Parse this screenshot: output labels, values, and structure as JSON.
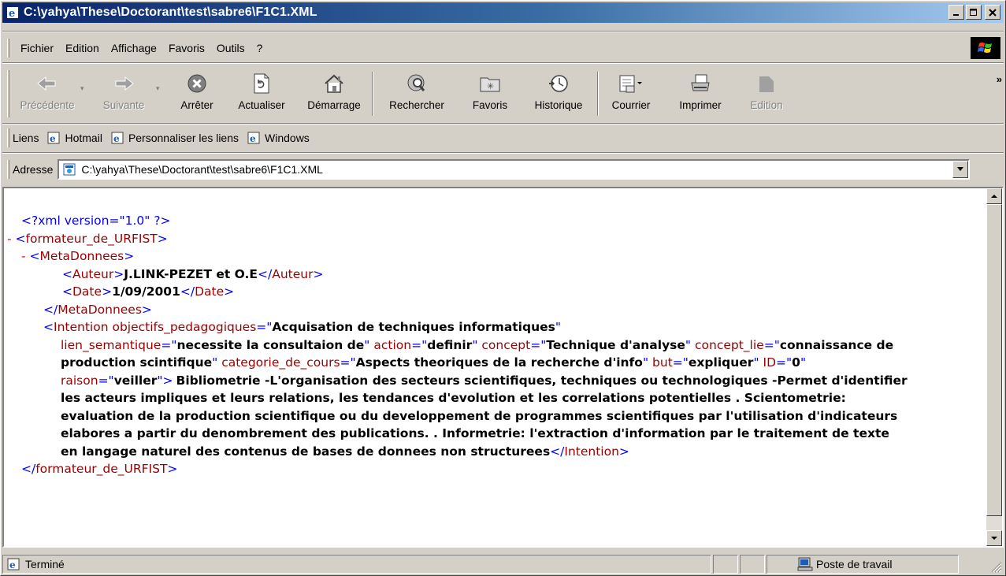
{
  "window": {
    "title": "C:\\yahya\\These\\Doctorant\\test\\sabre6\\F1C1.XML",
    "controls": {
      "minimize": "_",
      "maximize": "□",
      "close": "✕"
    }
  },
  "menu": [
    {
      "label": "Fichier"
    },
    {
      "label": "Edition"
    },
    {
      "label": "Affichage"
    },
    {
      "label": "Favoris"
    },
    {
      "label": "Outils"
    },
    {
      "label": "?"
    }
  ],
  "toolbar": {
    "back": {
      "label": "Précédente",
      "icon": "back-arrow-icon",
      "disabled": true
    },
    "forward": {
      "label": "Suivante",
      "icon": "forward-arrow-icon",
      "disabled": true
    },
    "stop": {
      "label": "Arrêter",
      "icon": "stop-icon"
    },
    "refresh": {
      "label": "Actualiser",
      "icon": "refresh-icon"
    },
    "home": {
      "label": "Démarrage",
      "icon": "home-icon"
    },
    "search": {
      "label": "Rechercher",
      "icon": "search-icon"
    },
    "favorites": {
      "label": "Favoris",
      "icon": "favorites-icon"
    },
    "history": {
      "label": "Historique",
      "icon": "history-icon"
    },
    "mail": {
      "label": "Courrier",
      "icon": "mail-icon"
    },
    "print": {
      "label": "Imprimer",
      "icon": "printer-icon"
    },
    "edit": {
      "label": "Edition",
      "icon": "edit-icon",
      "disabled": true
    },
    "more": "»"
  },
  "links": {
    "label": "Liens",
    "items": [
      {
        "label": "Hotmail"
      },
      {
        "label": "Personnaliser les liens"
      },
      {
        "label": "Windows"
      }
    ]
  },
  "address": {
    "label": "Adresse",
    "value": "C:\\yahya\\These\\Doctorant\\test\\sabre6\\F1C1.XML"
  },
  "xml": {
    "decl": "<?xml version=\"1.0\" ?>",
    "root": "formateur_de_URFIST",
    "meta": "MetaDonnees",
    "auteur_tag": "Auteur",
    "auteur_val": "J.LINK-PEZET et O.E",
    "date_tag": "Date",
    "date_val": "1/09/2001",
    "intention_tag": "Intention",
    "attrs": [
      {
        "name": "objectifs_pedagogiques",
        "value": "Acquisation de techniques informatiques"
      },
      {
        "name": "lien_semantique",
        "value": "necessite la consultaion de"
      },
      {
        "name": "action",
        "value": "definir"
      },
      {
        "name": "concept",
        "value": "Technique d'analyse"
      },
      {
        "name": "concept_lie",
        "value": "connaissance de production scintifique"
      },
      {
        "name": "categorie_de_cours",
        "value": "Aspects theoriques de la recherche d'info"
      },
      {
        "name": "but",
        "value": "expliquer"
      },
      {
        "name": "ID",
        "value": "0"
      },
      {
        "name": "raison",
        "value": "veiller"
      }
    ],
    "intention_text": "Bibliometrie -L'organisation des secteurs scientifiques, techniques ou technologiques -Permet d'identifier les acteurs impliques et leurs relations, les tendances d'evolution et les correlations potentielles . Scientometrie: evaluation de la production scientifique ou du developpement de programmes scientifiques par l'utilisation d'indicateurs elabores a partir du denombrement des publications. . Informetrie: l'extraction d'information par le traitement de texte en langage naturel des contenus de bases de donnees non structurees",
    "collapse": "-"
  },
  "status": {
    "text": "Terminé",
    "zone": "Poste de travail"
  },
  "colors": {
    "tag": "#0000ff",
    "element": "#990000",
    "attribute": "#990000",
    "collapse": "#ff0000",
    "titlebar_start": "#0a246a",
    "titlebar_end": "#a6caf0"
  }
}
